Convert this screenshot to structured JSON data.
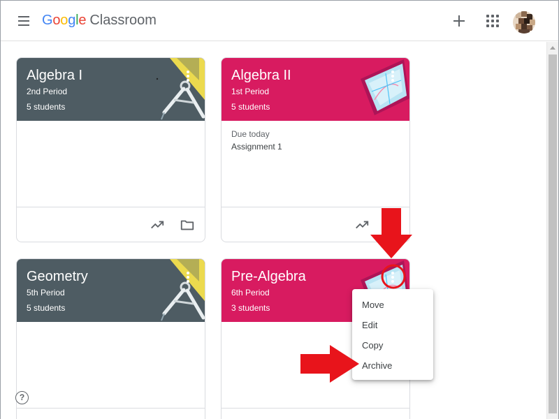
{
  "header": {
    "logo": {
      "letters": [
        {
          "ch": "G",
          "color": "#4285F4"
        },
        {
          "ch": "o",
          "color": "#EA4335"
        },
        {
          "ch": "o",
          "color": "#FBBC05"
        },
        {
          "ch": "g",
          "color": "#4285F4"
        },
        {
          "ch": "l",
          "color": "#34A853"
        },
        {
          "ch": "e",
          "color": "#EA4335"
        }
      ],
      "product": "Classroom"
    },
    "icons": [
      "menu-icon",
      "plus-icon",
      "apps-icon",
      "avatar"
    ]
  },
  "classes": [
    {
      "title": "Algebra I",
      "section": "2nd Period",
      "students": "5 students",
      "theme": "slate",
      "theme_color": "#4e5c63"
    },
    {
      "title": "Algebra II",
      "section": "1st Period",
      "students": "5 students",
      "theme": "pink",
      "theme_color": "#d81b60",
      "due": {
        "label": "Due today",
        "item": "Assignment 1"
      }
    },
    {
      "title": "Geometry",
      "section": "5th Period",
      "students": "5 students",
      "theme": "slate",
      "theme_color": "#4e5c63"
    },
    {
      "title": "Pre-Algebra",
      "section": "6th Period",
      "students": "3 students",
      "theme": "pink",
      "theme_color": "#d81b60"
    }
  ],
  "context_menu": {
    "items": [
      "Move",
      "Edit",
      "Copy",
      "Archive"
    ]
  },
  "footer_icons": [
    "trending-up-icon",
    "folder-icon"
  ],
  "help": {
    "glyph": "?"
  },
  "colors": {
    "annotation_red": "#e8141b",
    "text": "#3c4043",
    "icon_grey": "#5f6368"
  }
}
